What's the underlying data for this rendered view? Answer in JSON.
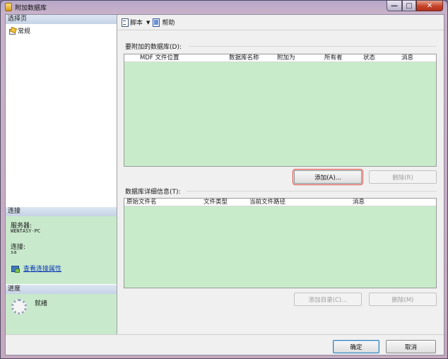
{
  "window": {
    "title": "附加数据库",
    "controls": {
      "minimize_glyph": "—",
      "maximize_glyph": "□",
      "close_glyph": "✕"
    }
  },
  "left_pane": {
    "select_page_header": "选择页",
    "nav_items": [
      {
        "label": "常规",
        "icon": "general-page-icon"
      }
    ],
    "connection_header": "连接",
    "server_label": "服务器:",
    "server_value": "WENTASY-PC",
    "connection_label": "连接:",
    "connection_value": "sa",
    "view_connection_properties": "查看连接属性",
    "progress_header": "进度",
    "progress_status": "就绪"
  },
  "toolbar": {
    "script_label": "脚本",
    "help_label": "帮助"
  },
  "attach_group": {
    "label": "要附加的数据库(D):",
    "columns": [
      "MDF 文件位置",
      "数据库名称",
      "附加为",
      "所有者",
      "状态",
      "消息"
    ],
    "rows": [],
    "add_button": "添加(A)...",
    "remove_button": "删除(R)"
  },
  "details_group": {
    "label": "数据库详细信息(T):",
    "columns": [
      "原始文件名",
      "文件类型",
      "当前文件路径",
      "消息"
    ],
    "rows": [],
    "add_catalog_button": "添加目录(C)...",
    "remove_button": "删除(M)"
  },
  "footer": {
    "ok_button": "确定",
    "cancel_button": "取消"
  },
  "colors": {
    "grid_background": "#c8ebca",
    "highlight_border": "#d9433a",
    "link": "#0a38b8"
  }
}
